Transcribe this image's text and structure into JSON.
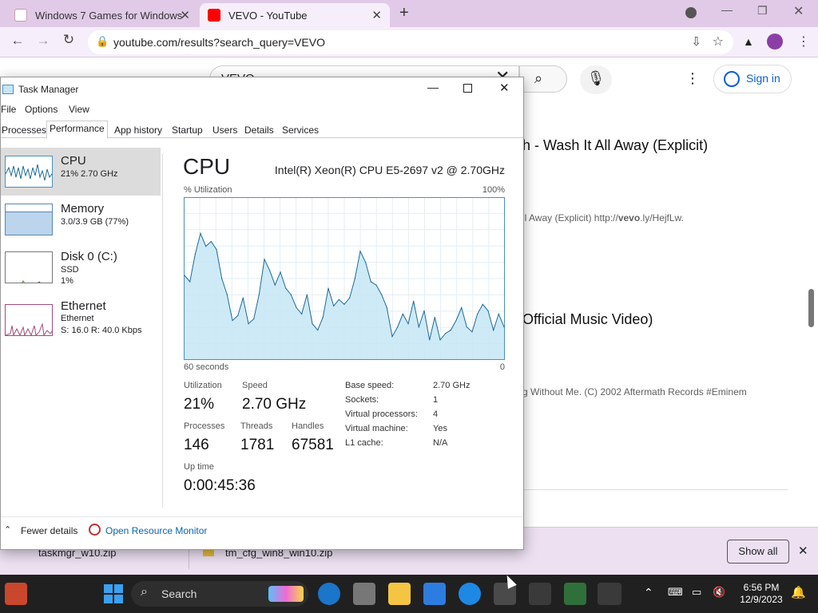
{
  "browser": {
    "tabs": [
      {
        "title": "Windows 7 Games for Windows",
        "active": false
      },
      {
        "title": "VEVO - YouTube",
        "active": true
      }
    ],
    "new_tab": "+",
    "url": "youtube.com/results?search_query=VEVO"
  },
  "youtube": {
    "search_value": "VEVO",
    "sign_in": "Sign in",
    "results": [
      {
        "title": "h - Wash It All Away (Explicit)",
        "desc": "ll Away (Explicit) http://",
        "desc_bold": "vevo",
        "desc_tail": ".ly/HejfLw."
      },
      {
        "title": "Official Music Video)",
        "desc": "g Without Me. (C) 2002 Aftermath Records #Eminem"
      }
    ]
  },
  "downloads": {
    "items": [
      "taskmgr_w10.zip",
      "tm_cfg_win8_win10.zip"
    ],
    "show_all": "Show all"
  },
  "taskbar": {
    "search": "Search",
    "time": "6:56 PM",
    "date": "12/9/2023"
  },
  "task_manager": {
    "title": "Task Manager",
    "menu": [
      "File",
      "Options",
      "View"
    ],
    "tabs": [
      "Processes",
      "Performance",
      "App history",
      "Startup",
      "Users",
      "Details",
      "Services"
    ],
    "sidebar": [
      {
        "name": "CPU",
        "sub1": "21%  2.70 GHz",
        "sub2": "",
        "sub3": ""
      },
      {
        "name": "Memory",
        "sub1": "3.0/3.9 GB (77%)",
        "sub2": "",
        "sub3": ""
      },
      {
        "name": "Disk 0 (C:)",
        "sub1": "SSD",
        "sub2": "1%",
        "sub3": ""
      },
      {
        "name": "Ethernet",
        "sub1": "Ethernet",
        "sub2": "S: 16.0  R: 40.0 Kbps",
        "sub3": ""
      }
    ],
    "header": "CPU",
    "cpu_model": "Intel(R) Xeon(R) CPU E5-2697 v2 @ 2.70GHz",
    "util_label": "% Utilization",
    "util_max": "100%",
    "time_left": "60 seconds",
    "time_right": "0",
    "stats": {
      "utilization_label": "Utilization",
      "utilization": "21%",
      "speed_label": "Speed",
      "speed": "2.70 GHz",
      "processes_label": "Processes",
      "processes": "146",
      "threads_label": "Threads",
      "threads": "1781",
      "handles_label": "Handles",
      "handles": "67581",
      "uptime_label": "Up time",
      "uptime": "0:00:45:36"
    },
    "details": [
      {
        "k": "Base speed:",
        "v": "2.70 GHz"
      },
      {
        "k": "Sockets:",
        "v": "1"
      },
      {
        "k": "Virtual processors:",
        "v": "4"
      },
      {
        "k": "Virtual machine:",
        "v": "Yes"
      },
      {
        "k": "L1 cache:",
        "v": "N/A"
      }
    ],
    "fewer_details": "Fewer details",
    "resource_monitor": "Open Resource Monitor"
  },
  "chart_data": {
    "type": "area",
    "title": "CPU",
    "ylabel": "% Utilization",
    "ylim": [
      0,
      100
    ],
    "x": [
      60,
      59,
      58,
      57,
      56,
      55,
      54,
      53,
      52,
      51,
      50,
      49,
      48,
      47,
      46,
      45,
      44,
      43,
      42,
      41,
      40,
      39,
      38,
      37,
      36,
      35,
      34,
      33,
      32,
      31,
      30,
      29,
      28,
      27,
      26,
      25,
      24,
      23,
      22,
      21,
      20,
      19,
      18,
      17,
      16,
      15,
      14,
      13,
      12,
      11,
      10,
      9,
      8,
      7,
      6,
      5,
      4,
      3,
      2,
      1,
      0
    ],
    "values": [
      52,
      48,
      65,
      78,
      70,
      73,
      68,
      50,
      40,
      24,
      27,
      38,
      22,
      25,
      40,
      62,
      55,
      46,
      54,
      44,
      40,
      32,
      28,
      40,
      22,
      18,
      26,
      44,
      33,
      37,
      34,
      38,
      50,
      67,
      60,
      48,
      46,
      40,
      32,
      14,
      20,
      28,
      22,
      36,
      20,
      30,
      12,
      26,
      12,
      16,
      18,
      24,
      32,
      20,
      17,
      28,
      34,
      30,
      18,
      28,
      20
    ]
  },
  "colors": {
    "accent": "#4a8fc4",
    "chart_fill": "#c6e6f4",
    "chart_line": "#1c6a9c",
    "tabstrip": "#e1cae8"
  }
}
